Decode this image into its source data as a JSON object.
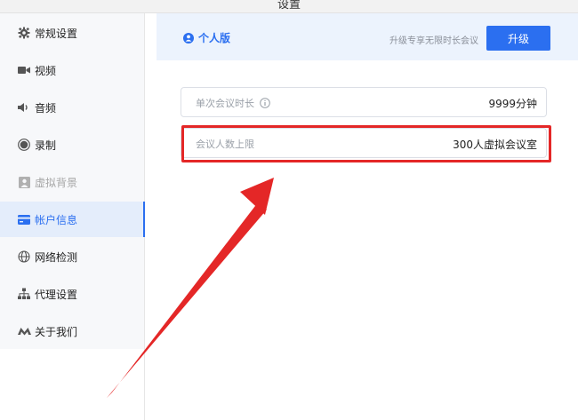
{
  "window": {
    "title": "设置"
  },
  "sidebar": {
    "items": [
      {
        "label": "常规设置",
        "icon": "gear-icon",
        "state": "normal"
      },
      {
        "label": "视频",
        "icon": "video-camera-icon",
        "state": "normal"
      },
      {
        "label": "音频",
        "icon": "speaker-icon",
        "state": "normal"
      },
      {
        "label": "录制",
        "icon": "record-icon",
        "state": "normal"
      },
      {
        "label": "虚拟背景",
        "icon": "virtual-background-icon",
        "state": "disabled"
      },
      {
        "label": "帐户信息",
        "icon": "card-icon",
        "state": "active"
      },
      {
        "label": "网络检测",
        "icon": "globe-icon",
        "state": "normal"
      },
      {
        "label": "代理设置",
        "icon": "network-tree-icon",
        "state": "normal"
      },
      {
        "label": "关于我们",
        "icon": "logo-icon",
        "state": "normal"
      }
    ]
  },
  "account": {
    "edition": "个人版",
    "upgrade_hint": "升级专享无限时长会议",
    "upgrade_button": "升级"
  },
  "details": [
    {
      "label": "单次会议时长",
      "value": "9999分钟",
      "info_icon": "info-icon"
    },
    {
      "label": "会议人数上限",
      "value": "300人虚拟会议室"
    }
  ],
  "colors": {
    "accent": "#2b6ff0",
    "highlight": "#e42727",
    "banner_bg": "#ecf3fd",
    "sidebar_active_bg": "#e4edfb"
  }
}
